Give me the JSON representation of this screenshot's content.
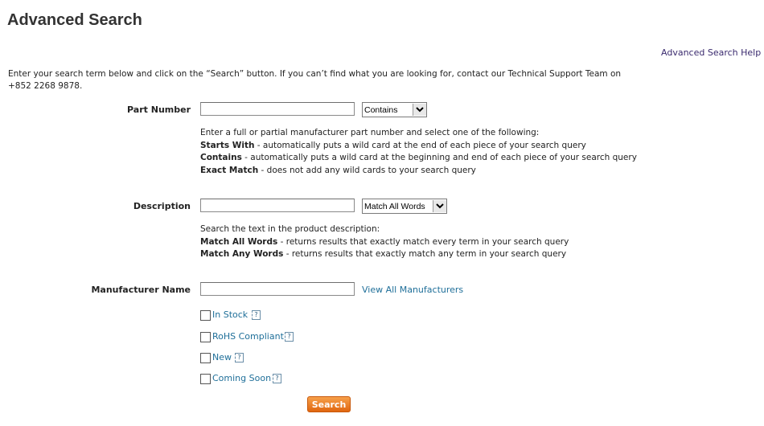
{
  "page": {
    "title": "Advanced Search",
    "help_link": "Advanced Search Help",
    "intro": "Enter your search term below and click on the “Search” button. If you can’t find what you are looking for, contact our Technical Support Team on +852 2268 9878."
  },
  "part_number": {
    "label": "Part Number",
    "value": "",
    "match_selected": "Contains",
    "hint_intro": "Enter a full or partial manufacturer part number and select one of the following:",
    "options": [
      {
        "name": "Starts With",
        "desc": " - automatically puts a wild card at the end of each piece of your search query"
      },
      {
        "name": "Contains",
        "desc": " - automatically puts a wild card at the beginning and end of each piece of your search query"
      },
      {
        "name": "Exact Match",
        "desc": " - does not add any wild cards to your search query"
      }
    ]
  },
  "description": {
    "label": "Description",
    "value": "",
    "match_selected": "Match All Words",
    "hint_intro": "Search the text in the product description:",
    "options": [
      {
        "name": "Match All Words",
        "desc": " - returns results that exactly match every term in your search query"
      },
      {
        "name": "Match Any Words",
        "desc": " - returns results that exactly match any term in your search query"
      }
    ]
  },
  "manufacturer": {
    "label": "Manufacturer Name",
    "value": "",
    "view_all_link": "View All Manufacturers"
  },
  "filters": [
    {
      "label": "In Stock",
      "checked": false
    },
    {
      "label": "RoHS Compliant",
      "checked": false
    },
    {
      "label": "New",
      "checked": false
    },
    {
      "label": "Coming Soon",
      "checked": false
    }
  ],
  "search_button": "Search",
  "colors": {
    "link": "#1f6f99",
    "help_link": "#3a2a6e",
    "button": "#e8731c"
  }
}
